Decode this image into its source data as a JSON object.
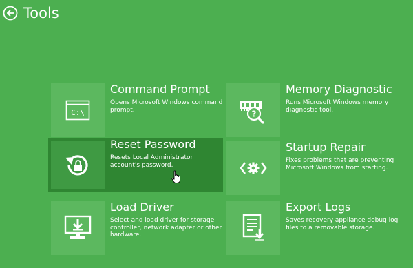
{
  "header": {
    "title": "Tools",
    "back_icon": "back-arrow-circle-icon"
  },
  "colors": {
    "background": "#4caf50",
    "tile_icon_bg": "#5cb85f",
    "selected_tile_bg": "#2f8632",
    "text": "#ffffff"
  },
  "tools": [
    {
      "title": "Command Prompt",
      "description": "Opens Microsoft Windows command prompt.",
      "icon": "command-prompt-icon"
    },
    {
      "title": "Memory Diagnostic",
      "description": "Runs Microsoft Windows memory diagnostic tool.",
      "icon": "memory-diagnostic-icon"
    },
    {
      "title": "Reset Password",
      "description": "Resets Local Administrator account's password.",
      "icon": "reset-password-icon",
      "selected": true
    },
    {
      "title": "Startup Repair",
      "description": "Fixes problems that are preventing Microsoft Windows from starting.",
      "icon": "startup-repair-icon"
    },
    {
      "title": "Load Driver",
      "description": "Select and load driver for storage controller, network adapter or other hardware.",
      "icon": "load-driver-icon"
    },
    {
      "title": "Export Logs",
      "description": "Saves recovery appliance debug log files to a removable storage.",
      "icon": "export-logs-icon"
    }
  ],
  "cmd_icon_text": "C:\\"
}
